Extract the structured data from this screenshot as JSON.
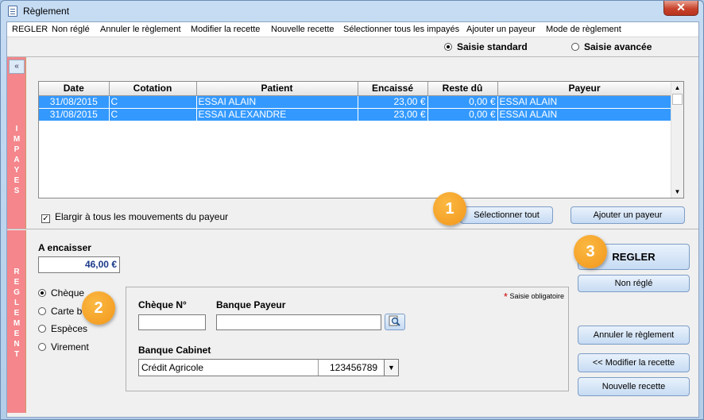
{
  "window": {
    "title": "Règlement",
    "close_glyph": "✕"
  },
  "menu": {
    "items": [
      "REGLER",
      "Non réglé",
      "Annuler le règlement",
      "Modifier la recette",
      "Nouvelle recette",
      "Sélectionner tous les impayés",
      "Ajouter un payeur",
      "Mode de règlement"
    ]
  },
  "mode": {
    "standard": "Saisie standard",
    "advanced": "Saisie avancée",
    "selected": "Saisie standard"
  },
  "impayes": {
    "side_label": "IMPAYES",
    "collapse_glyph": "«",
    "columns": [
      "Date",
      "Cotation",
      "Patient",
      "Encaissé",
      "Reste dû",
      "Payeur"
    ],
    "rows": [
      [
        "31/08/2015",
        "C",
        "ESSAI ALAIN",
        "23,00 €",
        "0,00 €",
        "ESSAI ALAIN"
      ],
      [
        "31/08/2015",
        "C",
        "ESSAI ALEXANDRE",
        "23,00 €",
        "0,00 €",
        "ESSAI ALAIN"
      ]
    ],
    "extend_label": "Elargir à tous les mouvements du payeur",
    "extend_checked": true,
    "select_all_button": "Sélectionner tout",
    "add_payer_button": "Ajouter un payeur"
  },
  "reglement": {
    "side_label": "REGLEMENT",
    "amount_label": "A encaisser",
    "amount_value": "46,00 €",
    "methods": [
      "Chèque",
      "Carte b",
      "Espèces",
      "Virement"
    ],
    "selected_method": "Chèque",
    "required_note": "Saisie obligatoire",
    "cheque_label": "Chèque N°",
    "cheque_value": "",
    "bank_label": "Banque Payeur",
    "bank_value": "",
    "cabinet_label": "Banque Cabinet",
    "cabinet_bank": "Crédit Agricole",
    "cabinet_account": "123456789",
    "buttons": {
      "regler": "REGLER",
      "non_regle": "Non réglé",
      "annuler": "Annuler le règlement",
      "modifier": "<< Modifier la recette",
      "nouvelle": "Nouvelle recette"
    }
  },
  "badges": [
    "1",
    "2",
    "3"
  ],
  "colors": {
    "selection": "#3399ff",
    "side_bar": "#f4868c",
    "badge": "#f2961a"
  }
}
